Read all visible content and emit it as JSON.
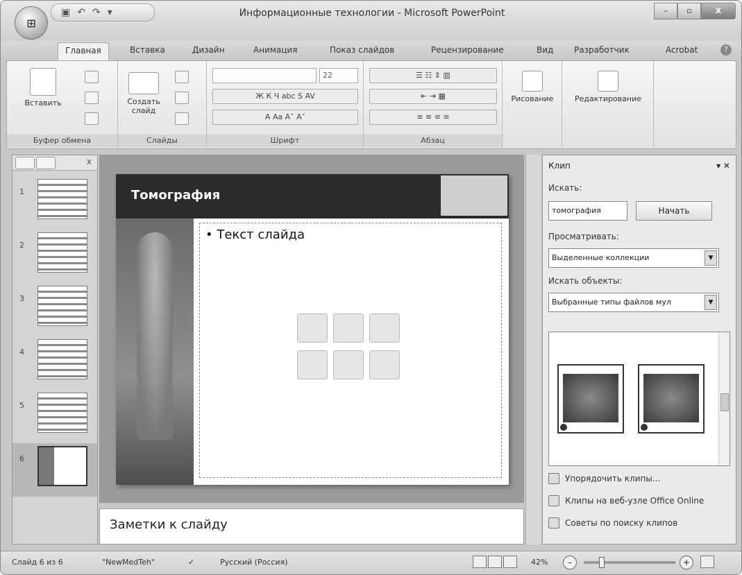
{
  "window": {
    "title": "Информационные технологии - Microsoft PowerPoint",
    "office_button": "",
    "minimize_label": "–",
    "restore_label": "▫",
    "close_label": "X"
  },
  "ribbon_tabs": [
    "Главная",
    "Вставка",
    "Дизайн",
    "Анимация",
    "Показ слайдов",
    "Рецензирование",
    "Вид",
    "Разработчик",
    "Acrobat"
  ],
  "ribbon": {
    "clipboard": {
      "paste": "Вставить",
      "group": "Буфер обмена"
    },
    "slides": {
      "create": "Создать слайд",
      "group": "Слайды"
    },
    "font": {
      "size": "22",
      "group": "Шрифт"
    },
    "paragraph": {
      "group": "Абзац"
    },
    "drawing": "Рисование",
    "editing": "Редактирование"
  },
  "slide": {
    "title": "Томография",
    "bullet": "• Текст слайда",
    "notes": "Заметки к слайду"
  },
  "thumbnails": [
    "1",
    "2",
    "3",
    "4",
    "5",
    "6"
  ],
  "clip_panel": {
    "title": "Клип",
    "search_label": "Искать:",
    "search_value": "томография",
    "start_button": "Начать",
    "browse_label": "Просматривать:",
    "browse_value": "Выделенные коллекции",
    "objects_label": "Искать объекты:",
    "objects_value": "Выбранные типы файлов мул",
    "organize": "Упорядочить клипы...",
    "online": "Клипы на веб-узле Office Online",
    "tips": "Советы по поиску клипов"
  },
  "status": {
    "slide": "Слайд 6 из 6",
    "theme": "\"NewMedTeh\"",
    "language": "Русский (Россия)",
    "zoom": "42%"
  }
}
